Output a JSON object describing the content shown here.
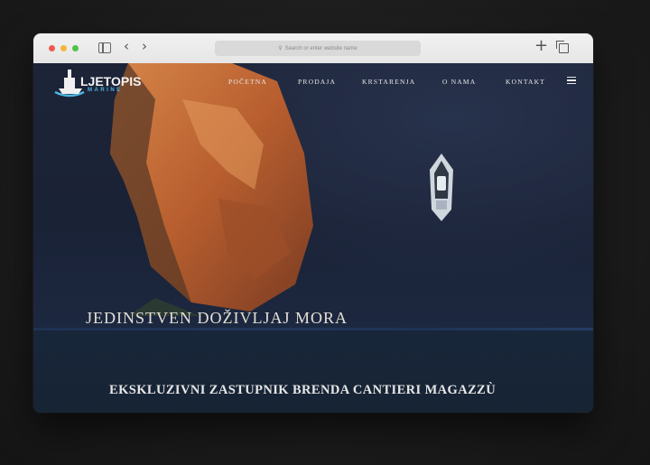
{
  "browser": {
    "address_placeholder": "Search or enter website name",
    "icons": [
      "close-dot",
      "minimize-dot",
      "zoom-dot",
      "sidebar-icon",
      "back-icon",
      "forward-icon",
      "plus-icon",
      "tabs-icon"
    ]
  },
  "site": {
    "logo": {
      "title": "LJETOPIS",
      "subtitle": "MARINE"
    },
    "nav": [
      "POČETNA",
      "PRODAJA",
      "KRSTARENJA",
      "O NAMA",
      "KONTAKT"
    ],
    "hero_title": "JEDINSTVEN DOŽIVLJAJ MORA",
    "tagline": "EKSKLUZIVNI ZASTUPNIK BRENDA CANTIERI MAGAZZÙ"
  },
  "colors": {
    "accent": "#4db5e0",
    "rock": "#c56a35",
    "sea": "#1a2236"
  }
}
